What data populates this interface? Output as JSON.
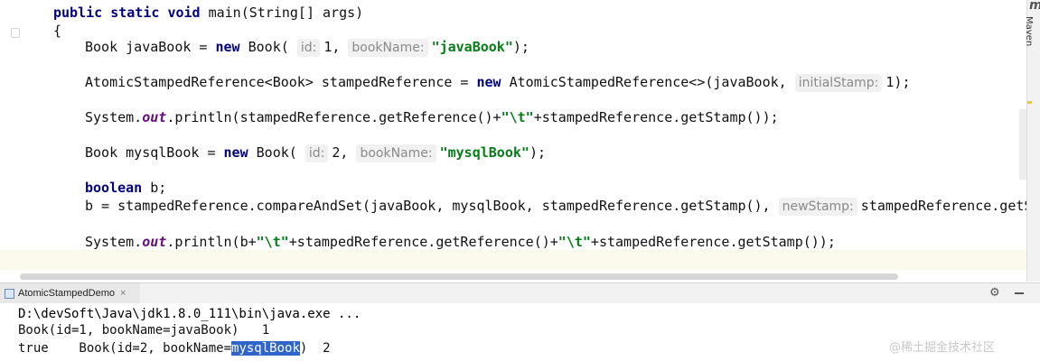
{
  "editor": {
    "method_signature": {
      "kw_public": "public",
      "kw_static": "static",
      "kw_void": "void",
      "rest": "main(String[] args)"
    },
    "open_brace": "{",
    "line_javabook": {
      "prefix": "Book javaBook = ",
      "kw_new": "new",
      "ctor": " Book(",
      "hint1_name": "id:",
      "hint1_value": "1",
      "comma": ",",
      "hint2_name": "bookName:",
      "str": "\"javaBook\"",
      "suffix": ");"
    },
    "line_stamped": {
      "prefix": "AtomicStampedReference<Book> stampedReference = ",
      "kw_new": "new",
      "ctor": " AtomicStampedReference<>(javaBook, ",
      "hint_name": "initialStamp:",
      "hint_value": "1",
      "suffix": ");"
    },
    "line_println1": {
      "prefix": "System.",
      "field": "out",
      "middle": ".println(stampedReference.getReference()+",
      "str": "\"\\t\"",
      "suffix": "+stampedReference.getStamp());"
    },
    "line_mysqlbook": {
      "prefix": "Book mysqlBook = ",
      "kw_new": "new",
      "ctor": " Book(",
      "hint1_name": "id:",
      "hint1_value": "2",
      "comma": ",",
      "hint2_name": "bookName:",
      "str": "\"mysqlBook\"",
      "suffix": ");"
    },
    "line_boolean": {
      "kw_boolean": "boolean",
      "rest": " b;"
    },
    "line_cas": {
      "prefix": "b = stampedReference.compareAndSet(javaBook, mysqlBook, stampedReference.getStamp(), ",
      "hint_name": "newStamp:",
      "suffix": "stampedReference.getSt"
    },
    "line_println2": {
      "prefix": "System.",
      "field": "out",
      "middle": ".println(b+",
      "str1": "\"\\t\"",
      "middle2": "+stampedReference.getReference()+",
      "str2": "\"\\t\"",
      "suffix": "+stampedReference.getStamp());"
    }
  },
  "right_strip": {
    "logo_letter": "m",
    "label": "Maven"
  },
  "run_panel": {
    "tab_label": "AtomicStampedDemo",
    "tab_close": "×",
    "gear_glyph": "⚙",
    "console": {
      "line1": "D:\\devSoft\\Java\\jdk1.8.0_111\\bin\\java.exe ...",
      "line2": "Book(id=1, bookName=javaBook)   1",
      "line3_prefix": "true    Book(id=2, bookName=",
      "line3_selected": "mysqlBook",
      "line3_suffix": ")  2"
    }
  },
  "watermark": "@稀土掘金技术社区"
}
